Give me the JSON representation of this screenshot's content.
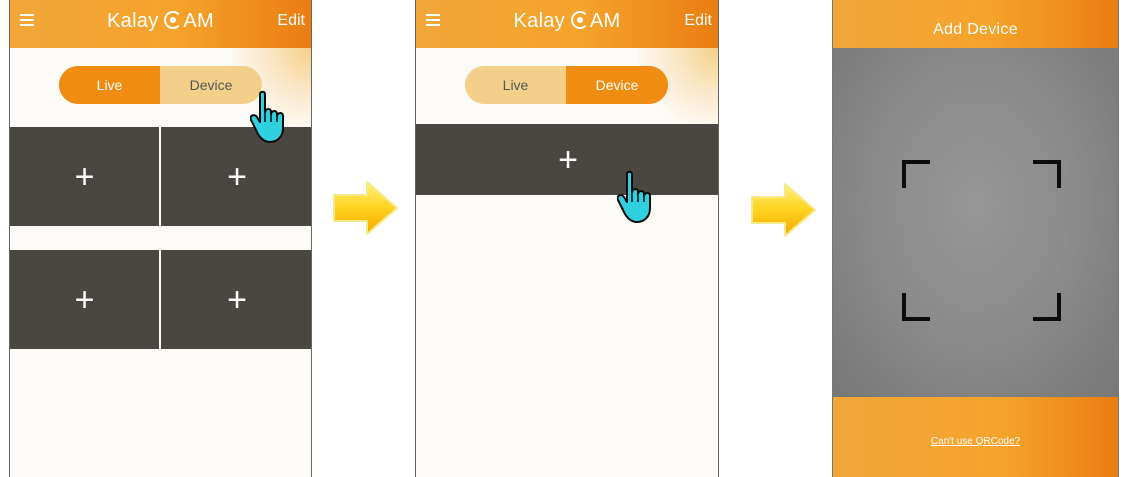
{
  "screen1": {
    "title": "Kalay",
    "title_suffix": "AM",
    "edit_label": "Edit",
    "tabs": [
      {
        "label": "Live",
        "active": true
      },
      {
        "label": "Device",
        "active": false
      }
    ],
    "tiles": [
      {
        "label": "+"
      },
      {
        "label": "+"
      },
      {
        "label": "+"
      },
      {
        "label": "+"
      }
    ]
  },
  "screen2": {
    "title": "Kalay",
    "title_suffix": "AM",
    "edit_label": "Edit",
    "tabs": [
      {
        "label": "Live",
        "active": false
      },
      {
        "label": "Device",
        "active": true
      }
    ],
    "add_tile": {
      "label": "+"
    }
  },
  "screen3": {
    "title": "Add Device",
    "qr_link": "Can't use QRCode?"
  },
  "icons": [
    "menu-icon",
    "camera-c-icon",
    "plus-icon",
    "pointing-hand-icon",
    "right-arrow-icon",
    "scan-corner-icon"
  ],
  "colors": {
    "accent": "#f5a32b",
    "accent_dark": "#ea7d12",
    "tile": "#4a4743",
    "active_tab": "#f08c12",
    "inactive_tab": "#f3cf8a",
    "hand": "#2fd0e0",
    "arrow": "#ffd21f"
  }
}
